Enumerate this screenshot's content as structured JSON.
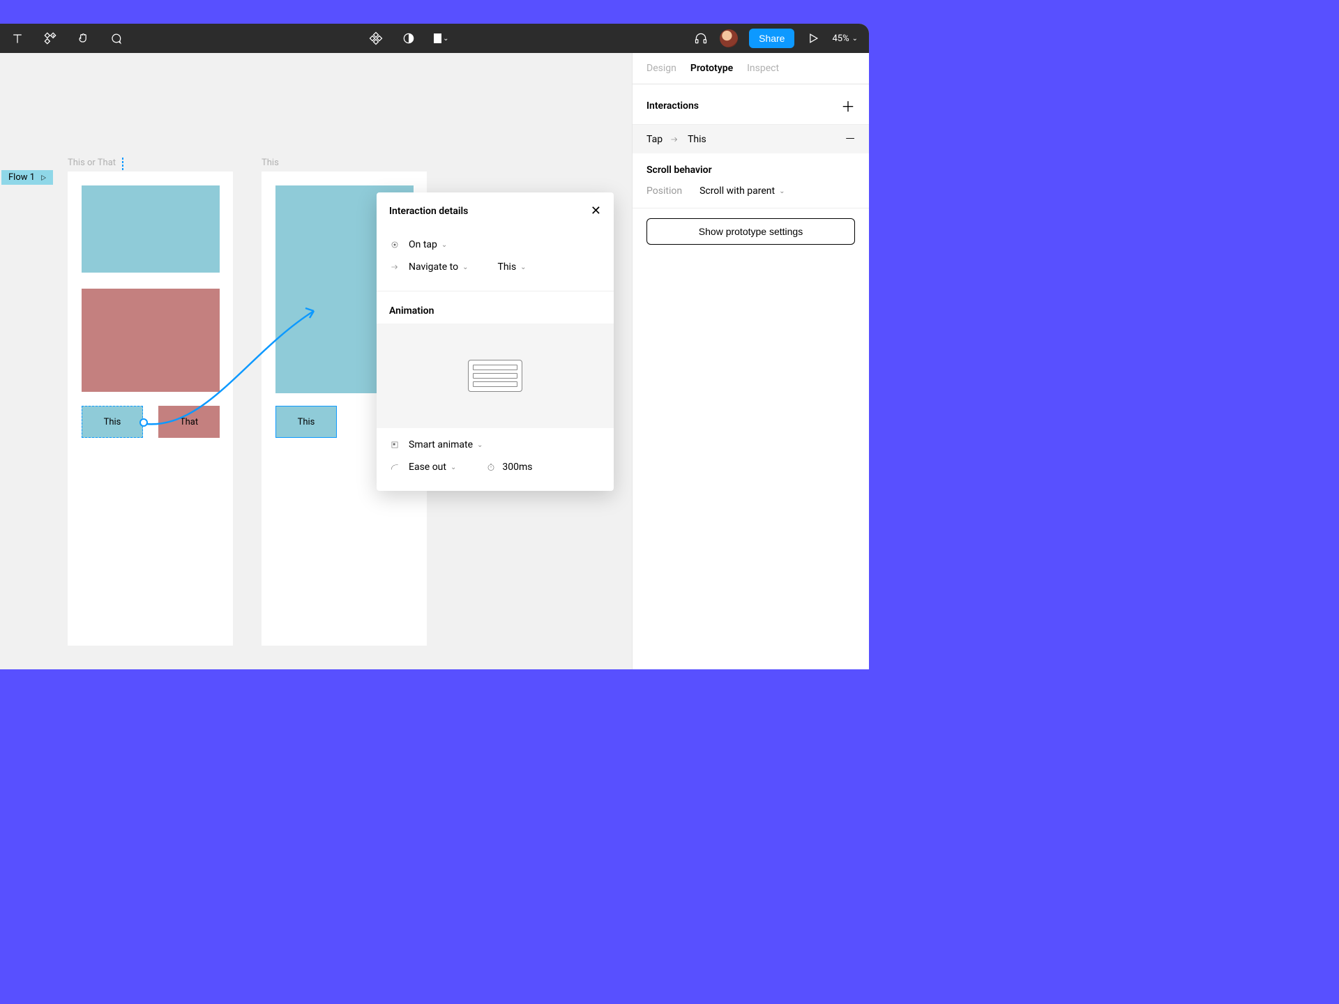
{
  "toolbar": {
    "share_label": "Share",
    "zoom": "45%"
  },
  "panel": {
    "tabs": {
      "design": "Design",
      "prototype": "Prototype",
      "inspect": "Inspect"
    },
    "interactions": {
      "title": "Interactions",
      "row_trigger": "Tap",
      "row_target": "This"
    },
    "scroll": {
      "title": "Scroll behavior",
      "position_label": "Position",
      "position_value": "Scroll with parent"
    },
    "proto_button": "Show prototype settings"
  },
  "popup": {
    "title": "Interaction details",
    "trigger": "On tap",
    "action": "Navigate to",
    "target": "This",
    "animation_title": "Animation",
    "animation_type": "Smart animate",
    "easing": "Ease out",
    "duration": "300ms"
  },
  "canvas": {
    "flow_label": "Flow 1",
    "frame1_title": "This or That",
    "frame2_title": "This",
    "btn_this": "This",
    "btn_that": "That",
    "btn_this2": "This"
  }
}
